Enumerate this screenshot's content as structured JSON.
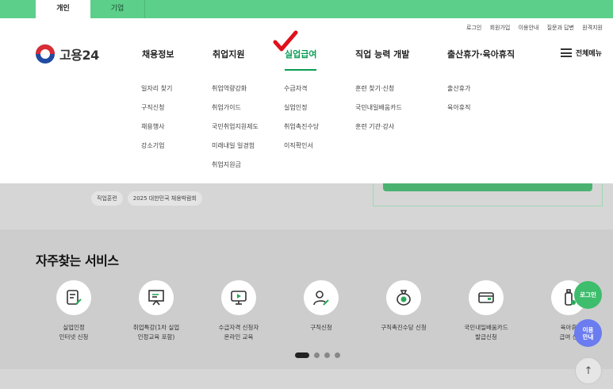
{
  "top_tabs": {
    "personal": "개인",
    "company": "기업"
  },
  "util_links": [
    "로그인",
    "회원가입",
    "이용안내",
    "질문과 답변",
    "원격지원"
  ],
  "logo": {
    "name": "고용24"
  },
  "gnb": [
    {
      "label": "채용정보"
    },
    {
      "label": "취업지원"
    },
    {
      "label": "실업급여"
    },
    {
      "label": "직업 능력 개발"
    },
    {
      "label": "출산휴가·육아휴직"
    }
  ],
  "active_menu": "실업급여",
  "all_menu": "전체메뉴",
  "submenus": {
    "jobs": [
      "일자리 찾기",
      "구직신청",
      "채용행사",
      "강소기업"
    ],
    "support": [
      "취업역량강화",
      "취업가이드",
      "국민취업지원제도",
      "미래내일 일경험",
      "취업지원금"
    ],
    "benefit": [
      "수급자격",
      "실업인정",
      "취업촉진수당",
      "이직확인서"
    ],
    "training": [
      "훈련 찾기·신청",
      "국민내일배움카드",
      "훈련 기관·강사"
    ],
    "leave": [
      "출산휴가",
      "육아휴직"
    ]
  },
  "tags": [
    "직업훈련",
    "2025 대한민국 채용박람회"
  ],
  "services": {
    "title": "자주찾는 서비스",
    "items": [
      {
        "label": "실업인정\n인터넷 신청",
        "icon": "document-pen-icon"
      },
      {
        "label": "취업특강(1차 실업\n인정교육 포함)",
        "icon": "presentation-board-icon"
      },
      {
        "label": "수급자격 신청자\n온라인 교육",
        "icon": "monitor-play-icon"
      },
      {
        "label": "구직신청",
        "icon": "person-pen-icon"
      },
      {
        "label": "구직촉진수당 신청",
        "icon": "money-bag-icon"
      },
      {
        "label": "국민내일배움카드\n발급신청",
        "icon": "card-icon"
      },
      {
        "label": "육아휴\n급여 신",
        "icon": "baby-bottle-icon"
      }
    ]
  },
  "floating": {
    "login": "로그인",
    "guide": "이용\n안내",
    "top": "↑"
  },
  "colors": {
    "brand_green": "#5ccf8b",
    "active_green": "#0a9d55",
    "check_red": "#e0101a",
    "guide_blue": "#6b7cf0"
  }
}
